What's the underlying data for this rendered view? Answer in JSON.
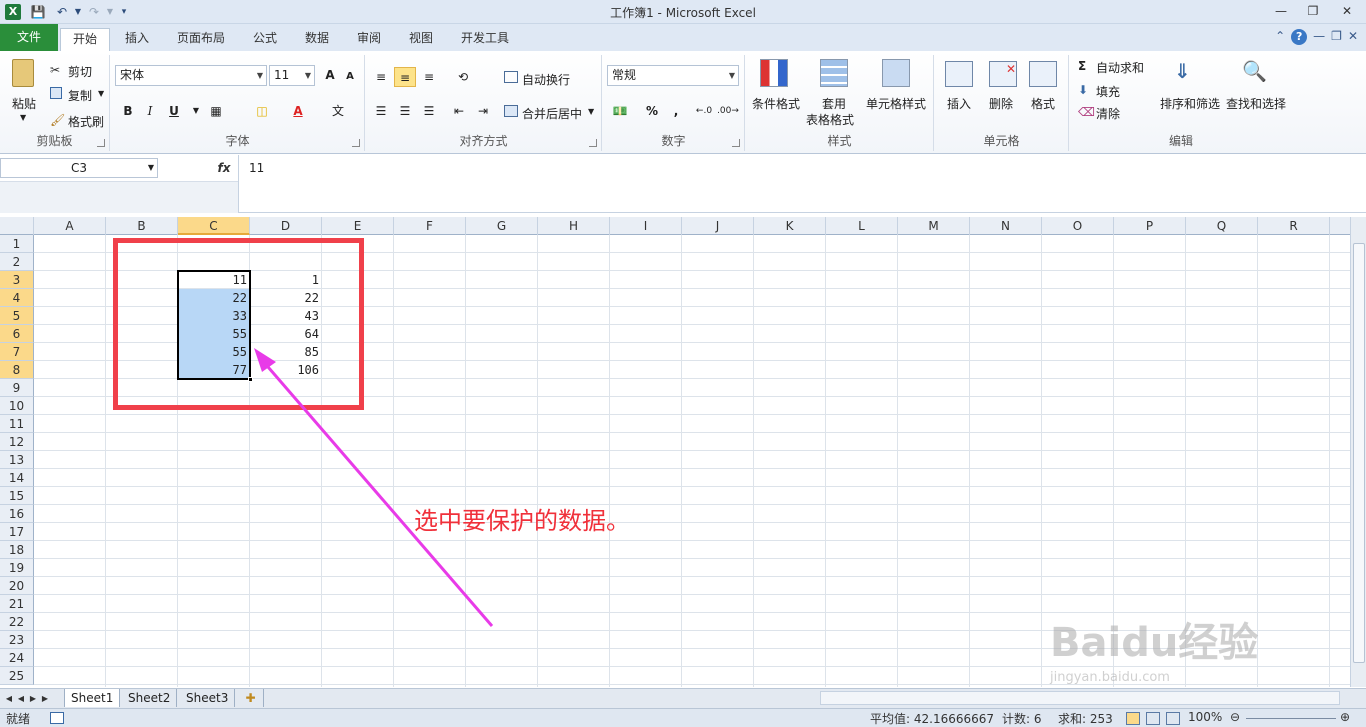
{
  "window": {
    "title": "工作簿1 - Microsoft Excel",
    "app_icon": "X"
  },
  "ribbon_tabs": {
    "file": "文件",
    "tabs": [
      "开始",
      "插入",
      "页面布局",
      "公式",
      "数据",
      "审阅",
      "视图",
      "开发工具"
    ]
  },
  "ribbon": {
    "clipboard": {
      "paste": "粘贴",
      "cut": "剪切",
      "copy": "复制",
      "format_painter": "格式刷",
      "label": "剪贴板"
    },
    "font": {
      "family": "宋体",
      "size": "11",
      "label": "字体",
      "bold": "B",
      "italic": "I",
      "underline": "U",
      "grow": "A",
      "shrink": "A",
      "color_letter": "A",
      "phonetic": "文"
    },
    "alignment": {
      "wrap": "自动换行",
      "merge": "合并后居中",
      "label": "对齐方式"
    },
    "number": {
      "format": "常规",
      "percent": "%",
      "comma": ",",
      "label": "数字"
    },
    "styles": {
      "conditional": "条件格式",
      "table_line1": "套用",
      "table_line2": "表格格式",
      "cell_styles": "单元格样式",
      "label": "样式"
    },
    "cells": {
      "insert": "插入",
      "delete": "删除",
      "format": "格式",
      "label": "单元格"
    },
    "editing": {
      "autosum": "自动求和",
      "fill": "填充",
      "clear": "清除",
      "sort": "排序和筛选",
      "find": "查找和选择",
      "label": "编辑"
    }
  },
  "formula_bar": {
    "name_box": "C3",
    "fx": "fx",
    "value": "11"
  },
  "columns": [
    "A",
    "B",
    "C",
    "D",
    "E",
    "F",
    "G",
    "H",
    "I",
    "J",
    "K",
    "L",
    "M",
    "N",
    "O",
    "P",
    "Q",
    "R"
  ],
  "rows": [
    "1",
    "2",
    "3",
    "4",
    "5",
    "6",
    "7",
    "8",
    "9",
    "10",
    "11",
    "12",
    "13",
    "14",
    "15",
    "16",
    "17",
    "18",
    "19",
    "20",
    "21",
    "22",
    "23",
    "24",
    "25"
  ],
  "cells": {
    "C": [
      "11",
      "22",
      "33",
      "55",
      "55",
      "77"
    ],
    "D": [
      "1",
      "22",
      "43",
      "64",
      "85",
      "106"
    ]
  },
  "sheets": [
    "Sheet1",
    "Sheet2",
    "Sheet3"
  ],
  "status": {
    "ready": "就绪",
    "average": "平均值: 42.16666667",
    "count": "计数: 6",
    "sum": "求和: 253",
    "zoom": "100%"
  },
  "annotation": {
    "text": "选中要保护的数据。",
    "color": "#f0303a"
  },
  "watermark": {
    "text": "Baidu经验",
    "url": "jingyan.baidu.com"
  },
  "colors": {
    "file_tab": "#2a8e3a",
    "selection": "#b8d7f6",
    "header_highlight": "#fbd98a",
    "annotation_red": "#f0404a",
    "arrow_magenta": "#e83be8"
  }
}
